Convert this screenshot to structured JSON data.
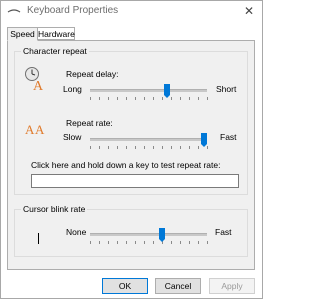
{
  "window": {
    "title": "Keyboard Properties",
    "close_glyph": "✕"
  },
  "tabs": [
    {
      "label": "Speed",
      "active": true
    },
    {
      "label": "Hardware",
      "active": false
    }
  ],
  "character_repeat": {
    "group_label": "Character repeat",
    "repeat_delay": {
      "label": "Repeat delay:",
      "min_label": "Long",
      "max_label": "Short",
      "value_fraction": 0.67
    },
    "repeat_rate": {
      "label": "Repeat rate:",
      "min_label": "Slow",
      "max_label": "Fast",
      "value_fraction": 1.0
    },
    "test_prompt": "Click here and hold down a key to test repeat rate:",
    "test_value": ""
  },
  "cursor_blink": {
    "group_label": "Cursor blink rate",
    "min_label": "None",
    "max_label": "Fast",
    "value_fraction": 0.62
  },
  "buttons": {
    "ok": "OK",
    "cancel": "Cancel",
    "apply": "Apply"
  },
  "icons": {
    "repeat_delay": "repeat-delay-icon",
    "repeat_rate": "repeat-rate-icon",
    "cursor": "cursor-icon"
  },
  "colors": {
    "accent": "#0078d7",
    "panel": "#f0f0f0",
    "disabled_text": "#9a9a9a"
  }
}
